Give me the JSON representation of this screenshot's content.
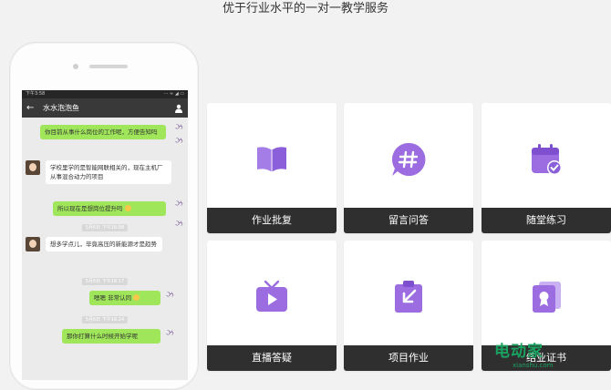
{
  "headline": "优于行业水平的一对一教学服务",
  "phone": {
    "status_time": "下午3:58",
    "status_icons": "··· ≈ ◢ ▭",
    "chat_title": "水水泡泡鱼",
    "back_icon": "arrow-left-icon",
    "contact_icon": "person-icon",
    "messages": [
      {
        "from": "out",
        "text": "你目前从事什么岗位的工作呢，方便告知吗"
      },
      {
        "from": "in",
        "text": "学校里学的是智能网联相关的，现在主机厂从事混合动力的项目"
      },
      {
        "from": "out",
        "text": "所以现在是想岗位提升吗"
      },
      {
        "from": "in",
        "text": "想多学点儿，毕竟高压的新能源才是趋势"
      },
      {
        "from": "out",
        "text": "嗯嗯  非常认同"
      },
      {
        "from": "out",
        "text": "那你打算什么时候开始学呢"
      }
    ],
    "timestamps": [
      "5月6日 下午16:08",
      "5月6日 下午16:17",
      "5月6日 下午16:24"
    ]
  },
  "cards": [
    {
      "label": "作业批复",
      "icon": "book-icon"
    },
    {
      "label": "留言问答",
      "icon": "hashtag-chat-icon"
    },
    {
      "label": "随堂练习",
      "icon": "calendar-check-icon"
    },
    {
      "label": "直播答疑",
      "icon": "tv-play-icon"
    },
    {
      "label": "项目作业",
      "icon": "clipboard-download-icon"
    },
    {
      "label": "结业证书",
      "icon": "certificate-icon"
    }
  ],
  "watermark": {
    "text": "电动家",
    "domain": "xianshu.com"
  },
  "colors": {
    "accent": "#9b6de0",
    "card_bar": "#2f2f2f",
    "bubble_out": "#9fe65a"
  }
}
